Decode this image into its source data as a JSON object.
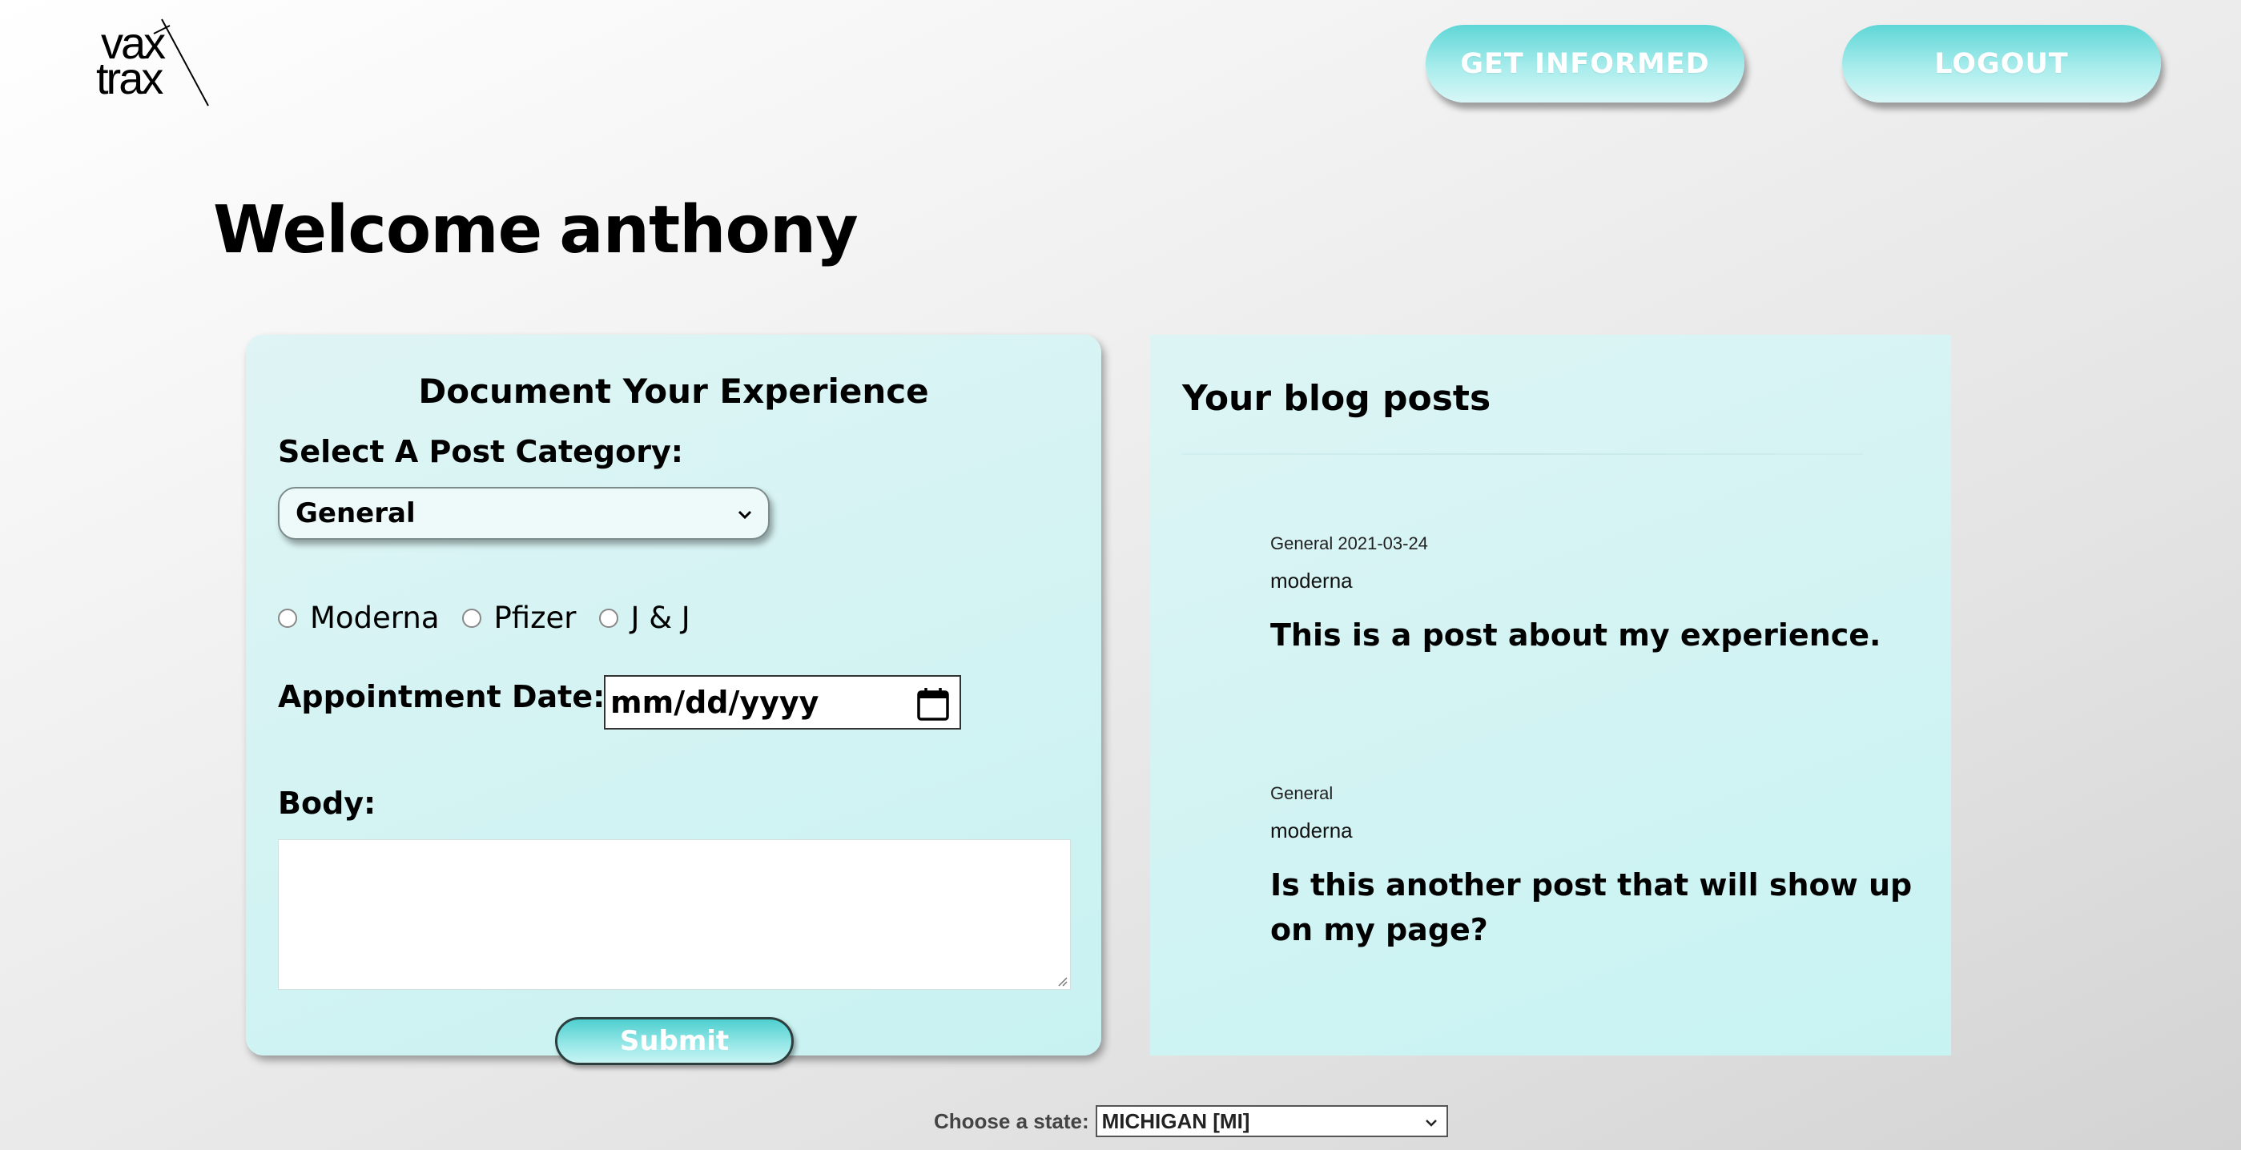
{
  "header": {
    "logo_line1": "vax",
    "logo_line2": "trax",
    "get_informed_label": "GET INFORMED",
    "logout_label": "LOGOUT"
  },
  "welcome": {
    "greeting": "Welcome",
    "username": "anthony"
  },
  "form": {
    "title": "Document Your Experience",
    "category_label": "Select A Post Category:",
    "category_selected": "General",
    "vaccines": [
      "Moderna",
      "Pfizer",
      "J & J"
    ],
    "date_label": "Appointment Date:",
    "date_placeholder": "mm/dd/yyyy",
    "body_label": "Body:",
    "body_value": "",
    "submit_label": "Submit"
  },
  "blog": {
    "title": "Your blog posts",
    "posts": [
      {
        "meta": "General 2021-03-24",
        "vaccine": "moderna",
        "text": "This is a post about my experience."
      },
      {
        "meta": "General",
        "vaccine": "moderna",
        "text": "Is this another post that will show up on my page?"
      }
    ]
  },
  "footer": {
    "state_label": "Choose a state:",
    "state_selected": "MICHIGAN [MI]"
  },
  "colors": {
    "accent_teal": "#5fd6d6",
    "card_bg": "#d4f3f3"
  }
}
